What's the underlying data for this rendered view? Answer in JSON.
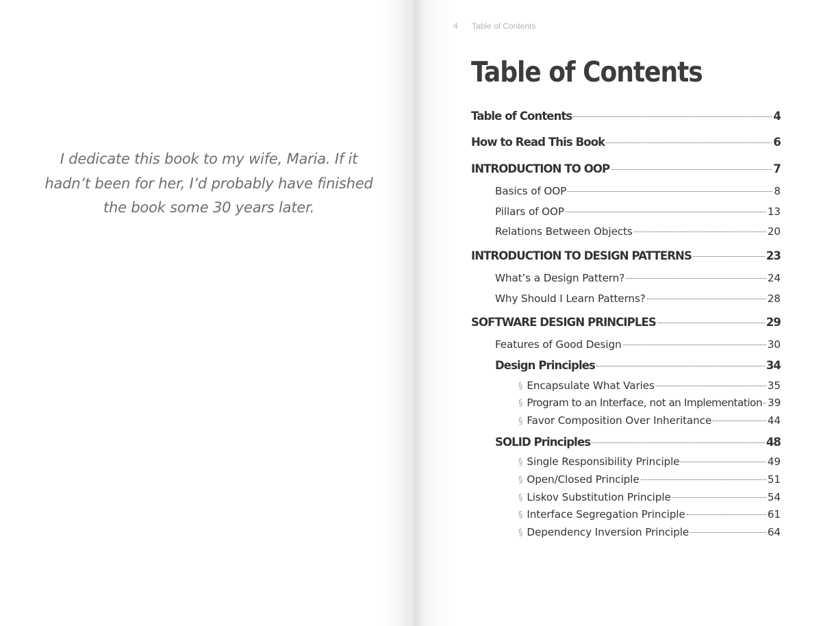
{
  "dedication": {
    "lines": [
      "I dedicate this book to my wife, Maria. If it",
      "hadn’t been for her, I’d probably have finished",
      "the book some 30 years later."
    ]
  },
  "running_head": {
    "page_number": "4",
    "section": "Table of Contents"
  },
  "title": "Table of Contents",
  "toc": [
    {
      "label": "Table of Contents",
      "page": "4"
    },
    {
      "label": "How to Read This Book",
      "page": "6"
    },
    {
      "label": "INTRODUCTION TO OOP",
      "page": "7"
    },
    {
      "label": "Basics of OOP",
      "page": "8"
    },
    {
      "label": "Pillars of OOP",
      "page": "13"
    },
    {
      "label": "Relations Between Objects",
      "page": "20"
    },
    {
      "label": "INTRODUCTION TO DESIGN PATTERNS",
      "page": "23"
    },
    {
      "label": "What’s a Design Pattern?",
      "page": "24"
    },
    {
      "label": "Why Should I Learn Patterns?",
      "page": "28"
    },
    {
      "label": "SOFTWARE DESIGN PRINCIPLES",
      "page": "29"
    },
    {
      "label": "Features of Good Design",
      "page": "30"
    },
    {
      "label": "Design Principles",
      "page": "34"
    },
    {
      "label": "Encapsulate What Varies",
      "page": "35"
    },
    {
      "label": "Program to an Interface, not an Implementation",
      "page": "39"
    },
    {
      "label": "Favor Composition Over Inheritance",
      "page": "44"
    },
    {
      "label": "SOLID Principles",
      "page": "48"
    },
    {
      "label": "Single Responsibility Principle",
      "page": "49"
    },
    {
      "label": "Open/Closed Principle",
      "page": "51"
    },
    {
      "label": "Liskov Substitution Principle",
      "page": "54"
    },
    {
      "label": "Interface Segregation Principle",
      "page": "61"
    },
    {
      "label": "Dependency Inversion Principle",
      "page": "64"
    }
  ],
  "bullet_glyph": "§",
  "colors": {
    "text": "#333333",
    "dedication": "#6e6e6e",
    "running_head": "#b3b3b3"
  }
}
